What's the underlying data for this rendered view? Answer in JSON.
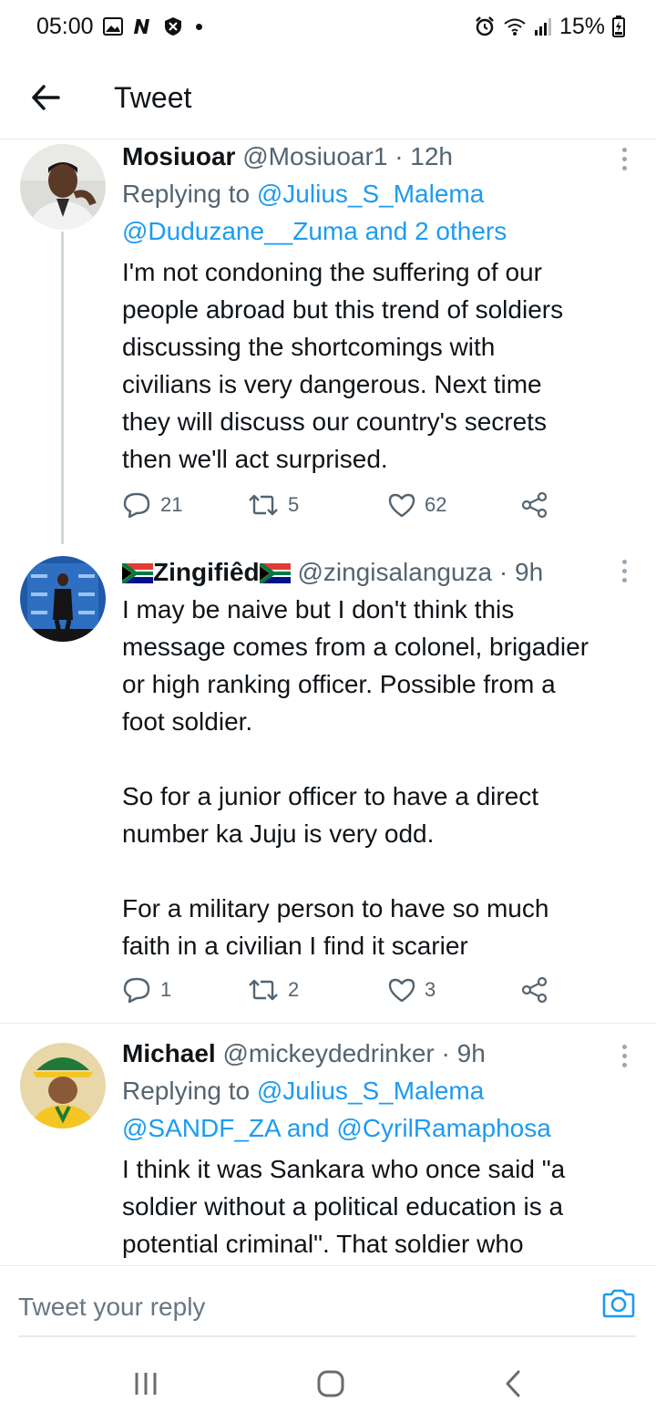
{
  "status_bar": {
    "time": "05:00",
    "battery": "15%"
  },
  "header": {
    "title": "Tweet"
  },
  "tweets": [
    {
      "name": "Mosiuoar",
      "handle": "@Mosiuoar1",
      "time": "· 12h",
      "replying_prefix": "Replying to",
      "replying_links": [
        "@Julius_S_Malema",
        "@Duduzane__Zuma and 2 others"
      ],
      "text": "I'm not condoning the suffering of our\npeople abroad but this trend of soldiers\ndiscussing the shortcomings with\ncivilians is very dangerous. Next time\nthey will discuss our country's secrets\nthen we'll act surprised.",
      "replies": "21",
      "retweets": "5",
      "likes": "62"
    },
    {
      "name": "Zingifiêd",
      "handle": "@zingisalanguza",
      "time": "· 9h",
      "text": "I may be naive but I don't think this\nmessage comes from a colonel, brigadier\nor high ranking officer. Possible from a\nfoot soldier.\n\nSo for a junior officer to have a direct\nnumber ka Juju is very odd.\n\nFor a military person to have so much\nfaith in a civilian I find it scarier",
      "replies": "1",
      "retweets": "2",
      "likes": "3"
    },
    {
      "name": "Michael",
      "handle": "@mickeydedrinker",
      "time": "· 9h",
      "replying_prefix": "Replying to",
      "replying_links": [
        "@Julius_S_Malema",
        "@SANDF_ZA and @CyrilRamaphosa"
      ],
      "text": "I think it was Sankara who once said \"a\nsoldier without a political education is a\npotential criminal\". That soldier who"
    }
  ],
  "reply": {
    "placeholder": "Tweet your reply"
  },
  "colors": {
    "accent": "#1d9bf0",
    "muted": "#536471",
    "text": "#0f1419",
    "divider": "#e6ecf0"
  },
  "icons": [
    "back-arrow-icon",
    "reply-icon",
    "retweet-icon",
    "like-icon",
    "share-icon",
    "more-icon",
    "camera-icon",
    "recent-apps-icon",
    "home-icon",
    "back-nav-icon"
  ]
}
